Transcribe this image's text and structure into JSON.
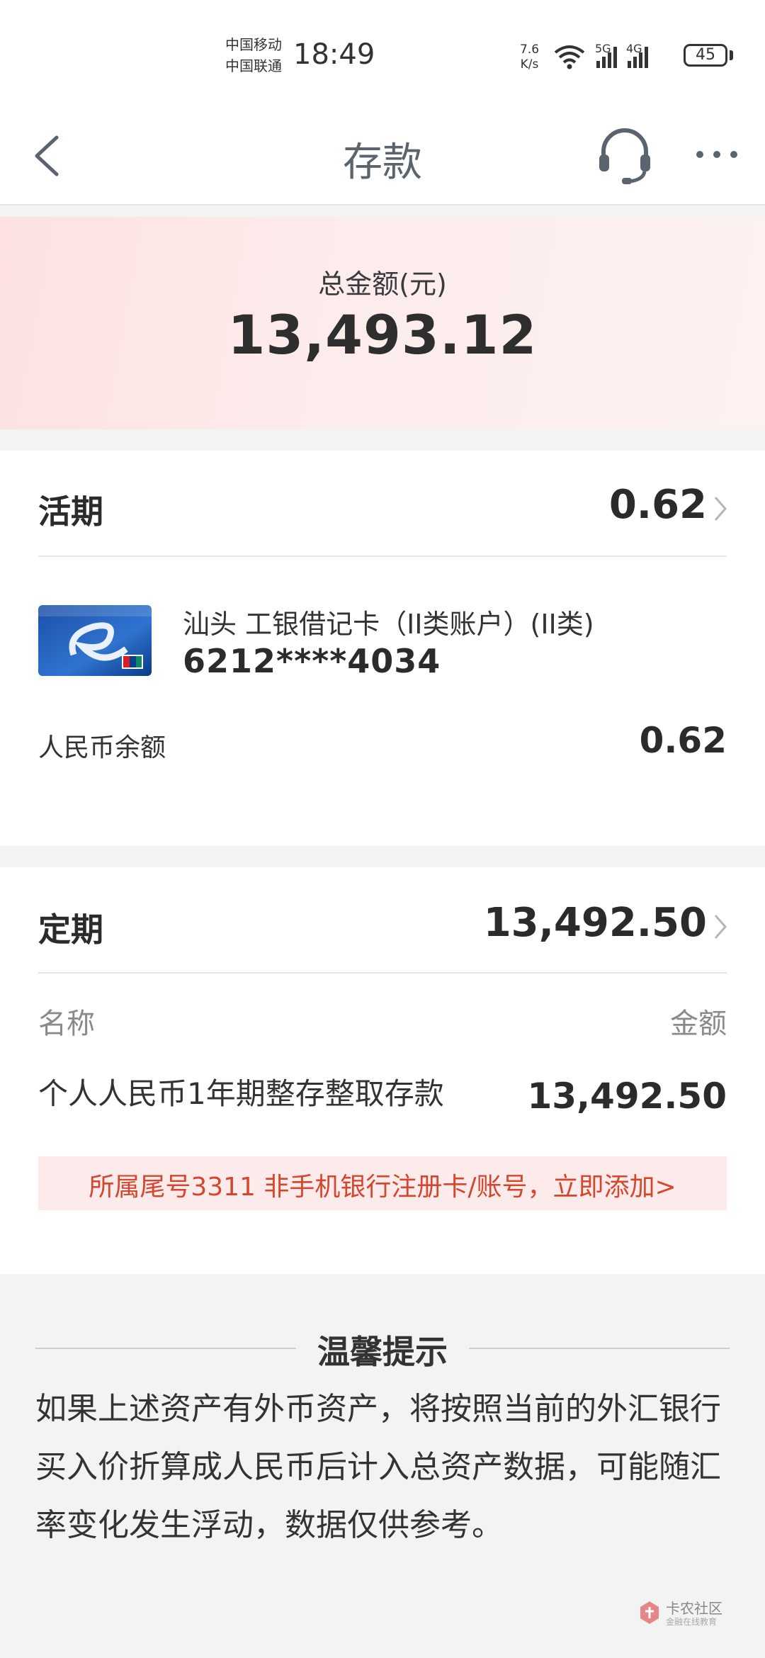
{
  "status_bar": {
    "carrier1": "中国移动",
    "carrier2": "中国联通",
    "time": "18:49",
    "net_speed": "7.6",
    "net_unit": "K/s",
    "sig1_label": "5G",
    "sig2_label": "4G",
    "battery": "45"
  },
  "nav": {
    "title": "存款"
  },
  "summary": {
    "label": "总金额(元)",
    "amount": "13,493.12"
  },
  "current": {
    "title": "活期",
    "total": "0.62",
    "account_name": "汕头 工银借记卡（II类账户）(II类)",
    "account_number": "6212****4034",
    "balance_label": "人民币余额",
    "balance": "0.62"
  },
  "fixed": {
    "title": "定期",
    "total": "13,492.50",
    "col_name": "名称",
    "col_amount": "金额",
    "item_name": "个人人民币1年期整存整取存款",
    "item_amount": "13,492.50",
    "notice": "所属尾号3311 非手机银行注册卡/账号，立即添加>"
  },
  "tips": {
    "title": "温馨提示",
    "body": "如果上述资产有外币资产，将按照当前的外汇银行买入价折算成人民币后计入总资产数据，可能随汇率变化发生浮动，数据仅供参考。"
  },
  "watermark": {
    "text": "卡农社区",
    "sub": "金融在线教育"
  },
  "colors": {
    "accent_red": "#d5462f",
    "notice_bg": "#fcebea",
    "nav_title": "#5b646e"
  }
}
